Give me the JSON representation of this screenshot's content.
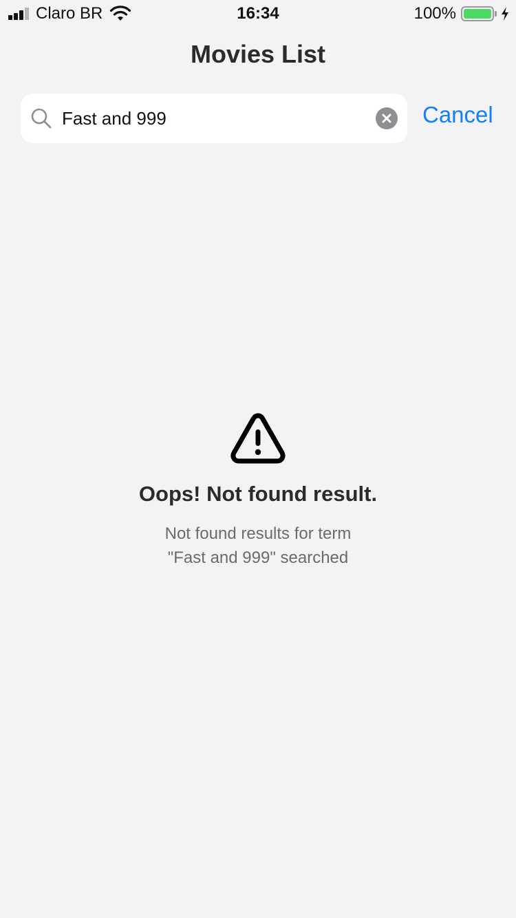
{
  "status_bar": {
    "carrier": "Claro BR",
    "time": "16:34",
    "battery_percent": "100%",
    "battery_color": "#4cd964",
    "signal_bars": 4,
    "signal_icon": "cellular-signal-icon",
    "wifi_icon": "wifi-icon",
    "battery_icon": "battery-icon",
    "charging_icon": "charging-bolt-icon"
  },
  "nav": {
    "title": "Movies List"
  },
  "search": {
    "value": "Fast and 999",
    "search_icon": "search-icon",
    "clear_icon": "clear-circle-icon",
    "cancel_label": "Cancel",
    "accent_color": "#147efb"
  },
  "empty_state": {
    "icon": "warning-icon",
    "title": "Oops! Not found result.",
    "message_line1": "Not found results for term",
    "message_line2": "\"Fast and 999\" searched"
  }
}
